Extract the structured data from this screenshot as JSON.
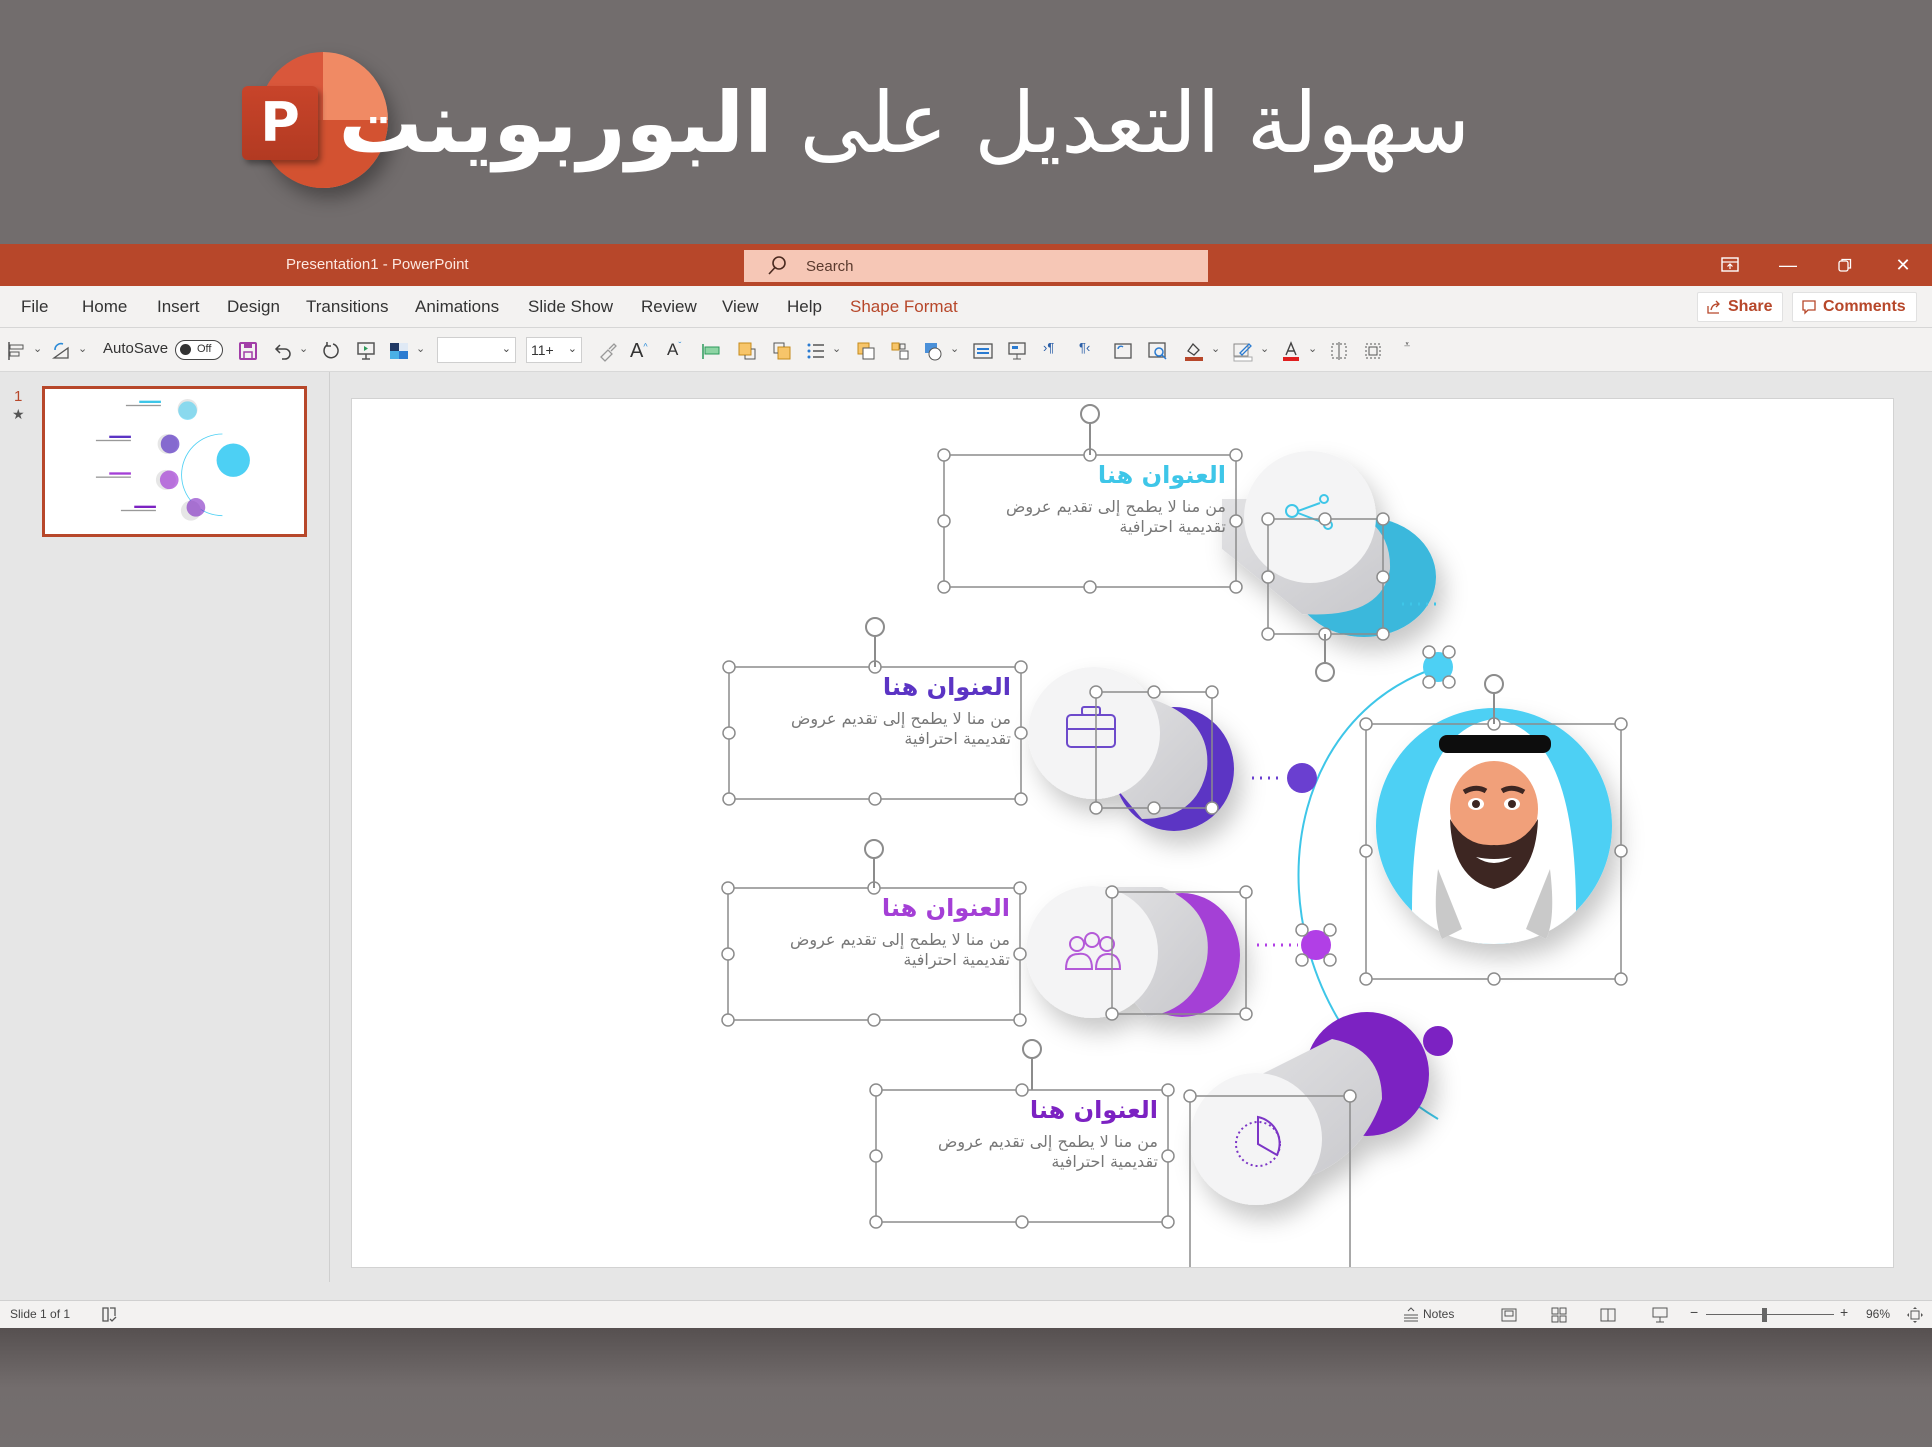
{
  "banner": {
    "logo_letter": "P",
    "title_regular": "سهولة التعديل على ",
    "title_bold": "البوربوينت"
  },
  "window": {
    "doc_title": "Presentation1  -  PowerPoint",
    "search_placeholder": "Search",
    "controls": [
      "ribbon-display-options",
      "minimize",
      "restore",
      "close"
    ]
  },
  "menu": {
    "tabs": [
      {
        "label": "File"
      },
      {
        "label": "Home"
      },
      {
        "label": "Insert"
      },
      {
        "label": "Design"
      },
      {
        "label": "Transitions"
      },
      {
        "label": "Animations"
      },
      {
        "label": "Slide Show"
      },
      {
        "label": "Review"
      },
      {
        "label": "View"
      },
      {
        "label": "Help"
      },
      {
        "label": "Shape Format",
        "active": true
      }
    ],
    "share_label": "Share",
    "comments_label": "Comments"
  },
  "toolbar": {
    "autosave_label": "AutoSave",
    "autosave_state": "Off",
    "font_name": "",
    "font_size": "11+"
  },
  "thumbnails": {
    "slide_number": "1",
    "star": "★"
  },
  "slide": {
    "items": [
      {
        "title": "العنوان هنا",
        "desc_line1": "من منا لا يطمح إلى تقديم عروض",
        "desc_line2": "تقديمية احترافية",
        "color": "#3ec6e8",
        "icon": "share-network-icon"
      },
      {
        "title": "العنوان هنا",
        "desc_line1": "من منا لا يطمح إلى تقديم عروض",
        "desc_line2": "تقديمية احترافية",
        "color": "#5b34c4",
        "icon": "briefcase-icon"
      },
      {
        "title": "العنوان هنا",
        "desc_line1": "من منا لا يطمح إلى تقديم عروض",
        "desc_line2": "تقديمية احترافية",
        "color": "#a43fd6",
        "icon": "group-people-icon"
      },
      {
        "title": "العنوان هنا",
        "desc_line1": "من منا لا يطمح إلى تقديم عروض",
        "desc_line2": "تقديمية احترافية",
        "color": "#7c22c2",
        "icon": "pie-chart-icon"
      }
    ],
    "avatar_ring_color": "#4dd0f4"
  },
  "statusbar": {
    "slide_info": "Slide 1 of 1",
    "notes_label": "Notes",
    "zoom_level": "96%",
    "zoom_fraction": 0.45
  }
}
